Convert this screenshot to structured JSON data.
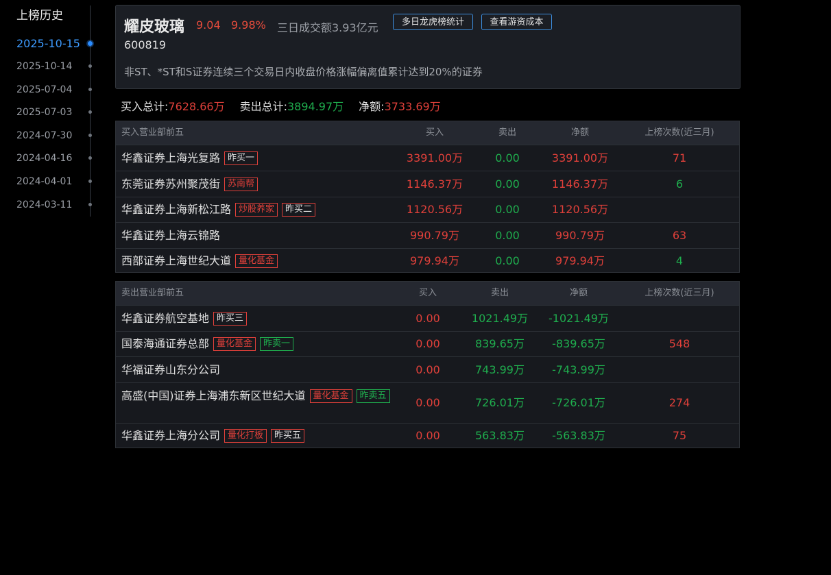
{
  "sidebar": {
    "title": "上榜历史",
    "dates": [
      "2025-10-15",
      "2025-10-14",
      "2025-07-04",
      "2025-07-03",
      "2024-07-30",
      "2024-04-16",
      "2024-04-01",
      "2024-03-11"
    ]
  },
  "header": {
    "name": "耀皮玻璃",
    "price": "9.04",
    "change": "9.98%",
    "turnover": "三日成交额3.93亿元",
    "btn_multi": "多日龙虎榜统计",
    "btn_cost": "查看游资成本",
    "code": "600819",
    "reason": "非ST、*ST和S证券连续三个交易日内收盘价格涨幅偏离值累计达到20%的证券"
  },
  "totals": {
    "buy_label": "买入总计:",
    "buy_value": "7628.66万",
    "sell_label": "卖出总计:",
    "sell_value": "3894.97万",
    "net_label": "净额:",
    "net_value": "3733.69万"
  },
  "buy_table": {
    "headers": [
      "买入营业部前五",
      "买入",
      "卖出",
      "净额",
      "上榜次数(近三月)"
    ],
    "rows": [
      {
        "name": "华鑫证券上海光复路",
        "tags": [
          {
            "t": "昨买一",
            "c": "w"
          }
        ],
        "buy": "3391.00万",
        "sell": "0.00",
        "net": "3391.00万",
        "count": "71"
      },
      {
        "name": "东莞证券苏州聚茂街",
        "tags": [
          {
            "t": "苏南帮",
            "c": "r"
          }
        ],
        "buy": "1146.37万",
        "sell": "0.00",
        "net": "1146.37万",
        "count": "6"
      },
      {
        "name": "华鑫证券上海新松江路",
        "tags": [
          {
            "t": "炒股养家",
            "c": "r"
          },
          {
            "t": "昨买二",
            "c": "w"
          }
        ],
        "buy": "1120.56万",
        "sell": "0.00",
        "net": "1120.56万",
        "count": ""
      },
      {
        "name": "华鑫证券上海云锦路",
        "tags": [],
        "buy": "990.79万",
        "sell": "0.00",
        "net": "990.79万",
        "count": "63"
      },
      {
        "name": "西部证券上海世纪大道",
        "tags": [
          {
            "t": "量化基金",
            "c": "r"
          }
        ],
        "buy": "979.94万",
        "sell": "0.00",
        "net": "979.94万",
        "count": "4"
      }
    ]
  },
  "sell_table": {
    "headers": [
      "卖出营业部前五",
      "买入",
      "卖出",
      "净额",
      "上榜次数(近三月)"
    ],
    "rows": [
      {
        "name": "华鑫证券航空基地",
        "tags": [
          {
            "t": "昨买三",
            "c": "w"
          }
        ],
        "buy": "0.00",
        "sell": "1021.49万",
        "net": "-1021.49万",
        "count": ""
      },
      {
        "name": "国泰海通证券总部",
        "tags": [
          {
            "t": "量化基金",
            "c": "r"
          },
          {
            "t": "昨卖一",
            "c": "g"
          }
        ],
        "buy": "0.00",
        "sell": "839.65万",
        "net": "-839.65万",
        "count": "548"
      },
      {
        "name": "华福证券山东分公司",
        "tags": [],
        "buy": "0.00",
        "sell": "743.99万",
        "net": "-743.99万",
        "count": ""
      },
      {
        "name": "高盛(中国)证券上海浦东新区世纪大道",
        "tags": [
          {
            "t": "量化基金",
            "c": "r"
          },
          {
            "t": "昨卖五",
            "c": "g"
          }
        ],
        "buy": "0.00",
        "sell": "726.01万",
        "net": "-726.01万",
        "count": "274"
      },
      {
        "name": "华鑫证券上海分公司",
        "tags": [
          {
            "t": "量化打板",
            "c": "r"
          },
          {
            "t": "昨买五",
            "c": "w"
          }
        ],
        "buy": "0.00",
        "sell": "563.83万",
        "net": "-563.83万",
        "count": "75"
      }
    ]
  }
}
